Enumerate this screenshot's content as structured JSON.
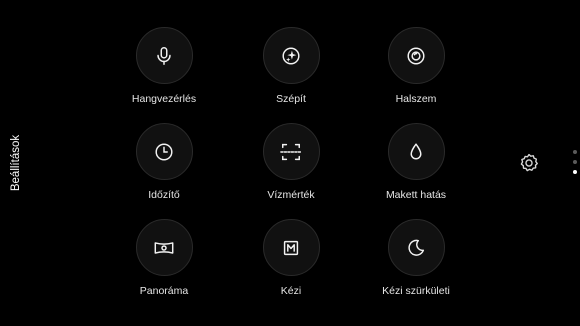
{
  "side_panel": {
    "title": "Beállítások"
  },
  "modes": [
    {
      "label": "Hangvezérlés",
      "icon": "microphone-icon"
    },
    {
      "label": "Szépít",
      "icon": "beauty-sparkle-icon"
    },
    {
      "label": "Halszem",
      "icon": "fisheye-lens-icon"
    },
    {
      "label": "Időzítő",
      "icon": "timer-clock-icon"
    },
    {
      "label": "Vízmérték",
      "icon": "level-frame-icon"
    },
    {
      "label": "Makett hatás",
      "icon": "drop-icon"
    },
    {
      "label": "Panoráma",
      "icon": "panorama-icon"
    },
    {
      "label": "Kézi",
      "icon": "manual-m-icon"
    },
    {
      "label": "Kézi szürkületi",
      "icon": "moon-icon"
    }
  ],
  "settings_icon": "gear-icon",
  "page_indicator": {
    "total": 3,
    "active_index": 2
  },
  "colors": {
    "background": "#000000",
    "circle": "#111111",
    "text": "#e6e6e6",
    "dot_inactive": "#5a5a5a",
    "dot_active": "#ffffff"
  }
}
